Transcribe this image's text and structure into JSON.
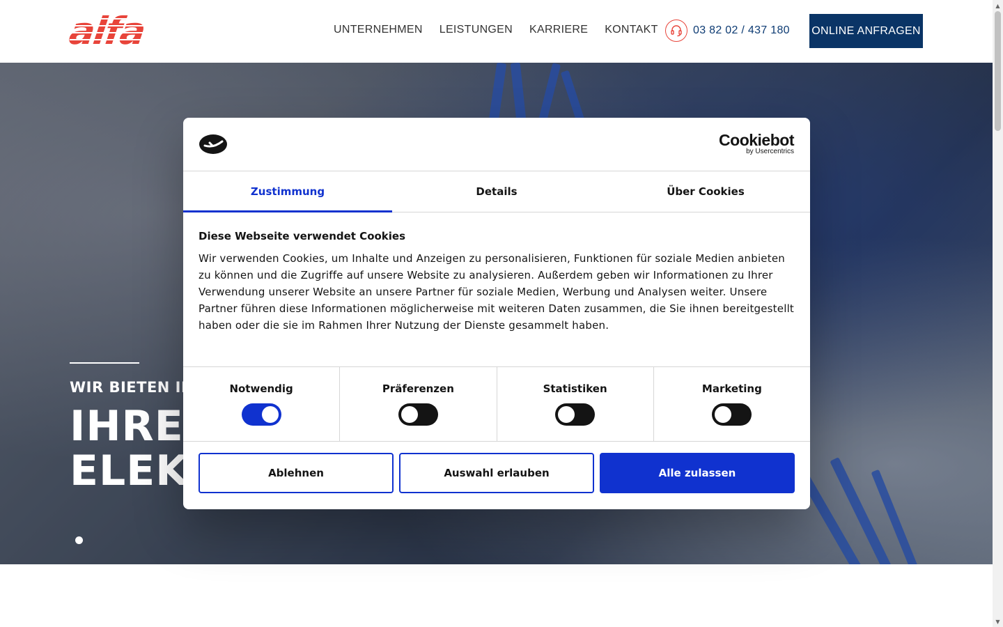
{
  "header": {
    "logo_text": "alfa",
    "nav": [
      "UNTERNEHMEN",
      "LEISTUNGEN",
      "KARRIERE",
      "KONTAKT"
    ],
    "phone": "03 82 02 / 437 180",
    "cta": "ONLINE ANFRAGEN"
  },
  "hero": {
    "kicker": "WIR BIETEN IHN",
    "title_line1": "IHRE S",
    "title_line2": "ELEKT"
  },
  "cookie": {
    "brand_name": "Cookiebot",
    "brand_sub": "by Usercentrics",
    "tabs": [
      {
        "label": "Zustimmung",
        "active": true
      },
      {
        "label": "Details",
        "active": false
      },
      {
        "label": "Über Cookies",
        "active": false
      }
    ],
    "title": "Diese Webseite verwendet Cookies",
    "text": "Wir verwenden Cookies, um Inhalte und Anzeigen zu personalisieren, Funktionen für soziale Medien anbieten zu können und die Zugriffe auf unsere Website zu analysieren. Außerdem geben wir Informationen zu Ihrer Verwendung unserer Website an unsere Partner für soziale Medien, Werbung und Analysen weiter. Unsere Partner führen diese Informationen möglicherweise mit weiteren Daten zusammen, die Sie ihnen bereitgestellt haben oder die sie im Rahmen Ihrer Nutzung der Dienste gesammelt haben.",
    "toggles": [
      {
        "label": "Notwendig",
        "on": true
      },
      {
        "label": "Präferenzen",
        "on": false
      },
      {
        "label": "Statistiken",
        "on": false
      },
      {
        "label": "Marketing",
        "on": false
      }
    ],
    "buttons": {
      "decline": "Ablehnen",
      "allow_selection": "Auswahl erlauben",
      "allow_all": "Alle zulassen"
    }
  },
  "colors": {
    "brand_red": "#e8443a",
    "header_blue": "#0a3466",
    "cookiebot_blue": "#1032cf"
  },
  "icons": [
    "headset-icon",
    "cookiebot-logo-icon"
  ]
}
